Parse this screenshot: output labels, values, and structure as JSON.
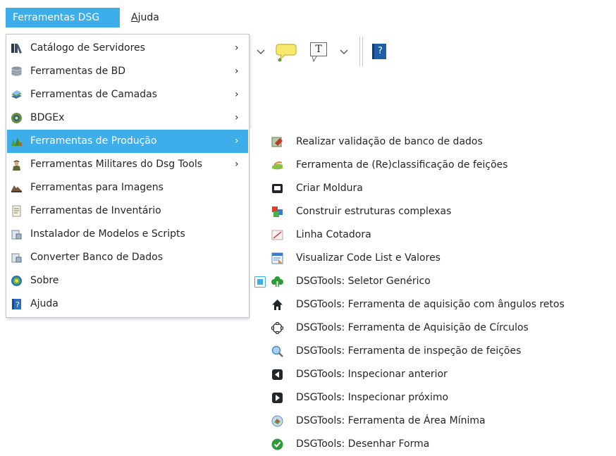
{
  "menubar": {
    "items": [
      {
        "label": "Ferramentas DSG"
      },
      {
        "label_mnemonic": "A",
        "label_rest": "juda"
      }
    ]
  },
  "toolbar": {
    "icons": [
      "chevron-down-icon",
      "speech-bubble-icon",
      "text-annotation-icon",
      "chevron-down-icon",
      "help-book-icon"
    ],
    "text_annotation_glyph": "T",
    "help_glyph": "?"
  },
  "menu": {
    "items": [
      {
        "label": "Catálogo de Servidores",
        "icon": "server-catalog-icon",
        "submenu": true
      },
      {
        "label": "Ferramentas de BD",
        "icon": "database-icon",
        "submenu": true
      },
      {
        "label": "Ferramentas de Camadas",
        "icon": "layers-icon",
        "submenu": true
      },
      {
        "label": "BDGEx",
        "icon": "bdgex-icon",
        "submenu": true
      },
      {
        "label": "Ferramentas de Produção",
        "icon": "production-icon",
        "submenu": true
      },
      {
        "label": "Ferramentas Militares do Dsg Tools",
        "icon": "soldier-icon",
        "submenu": true
      },
      {
        "label": "Ferramentas para Imagens",
        "icon": "image-tools-icon",
        "submenu": false
      },
      {
        "label": "Ferramentas de Inventário",
        "icon": "inventory-icon",
        "submenu": false
      },
      {
        "label": "Instalador de Modelos e Scripts",
        "icon": "installer-icon",
        "submenu": false
      },
      {
        "label": "Converter Banco de Dados",
        "icon": "convert-db-icon",
        "submenu": false
      },
      {
        "label": "Sobre",
        "icon": "about-icon",
        "submenu": false
      },
      {
        "label": "Ajuda",
        "icon": "help-book-icon",
        "submenu": false
      }
    ],
    "submenu_arrow": "›"
  },
  "submenu": {
    "items": [
      {
        "label": "Realizar validação de banco de dados",
        "icon": "validation-icon"
      },
      {
        "label": "Ferramenta de (Re)classificação de feições",
        "icon": "reclassify-icon"
      },
      {
        "label": "Criar Moldura",
        "icon": "frame-icon"
      },
      {
        "label": "Construir estruturas complexas",
        "icon": "complex-structures-icon"
      },
      {
        "label": "Linha Cotadora",
        "icon": "dimension-line-icon"
      },
      {
        "label": "Visualizar Code List e Valores",
        "icon": "code-list-icon"
      },
      {
        "label": "DSGTools: Seletor Genérico",
        "icon": "generic-selector-icon",
        "checked": true
      },
      {
        "label": "DSGTools: Ferramenta de aquisição com ângulos retos",
        "icon": "right-angle-icon"
      },
      {
        "label": "DSGTools: Ferramenta de Aquisição de Círculos",
        "icon": "circle-icon"
      },
      {
        "label": "DSGTools: Ferramenta de inspeção de feições",
        "icon": "magnifier-icon"
      },
      {
        "label": "DSGTools: Inspecionar anterior",
        "icon": "previous-icon"
      },
      {
        "label": "DSGTools: Inspecionar próximo",
        "icon": "next-icon"
      },
      {
        "label": "DSGTools: Ferramenta de Área Mínima",
        "icon": "minimum-area-icon"
      },
      {
        "label": "DSGTools: Desenhar Forma",
        "icon": "draw-shape-icon"
      }
    ]
  },
  "colors": {
    "highlight": "#3daee9",
    "text": "#232629",
    "menu_border": "#c4c7cb"
  }
}
